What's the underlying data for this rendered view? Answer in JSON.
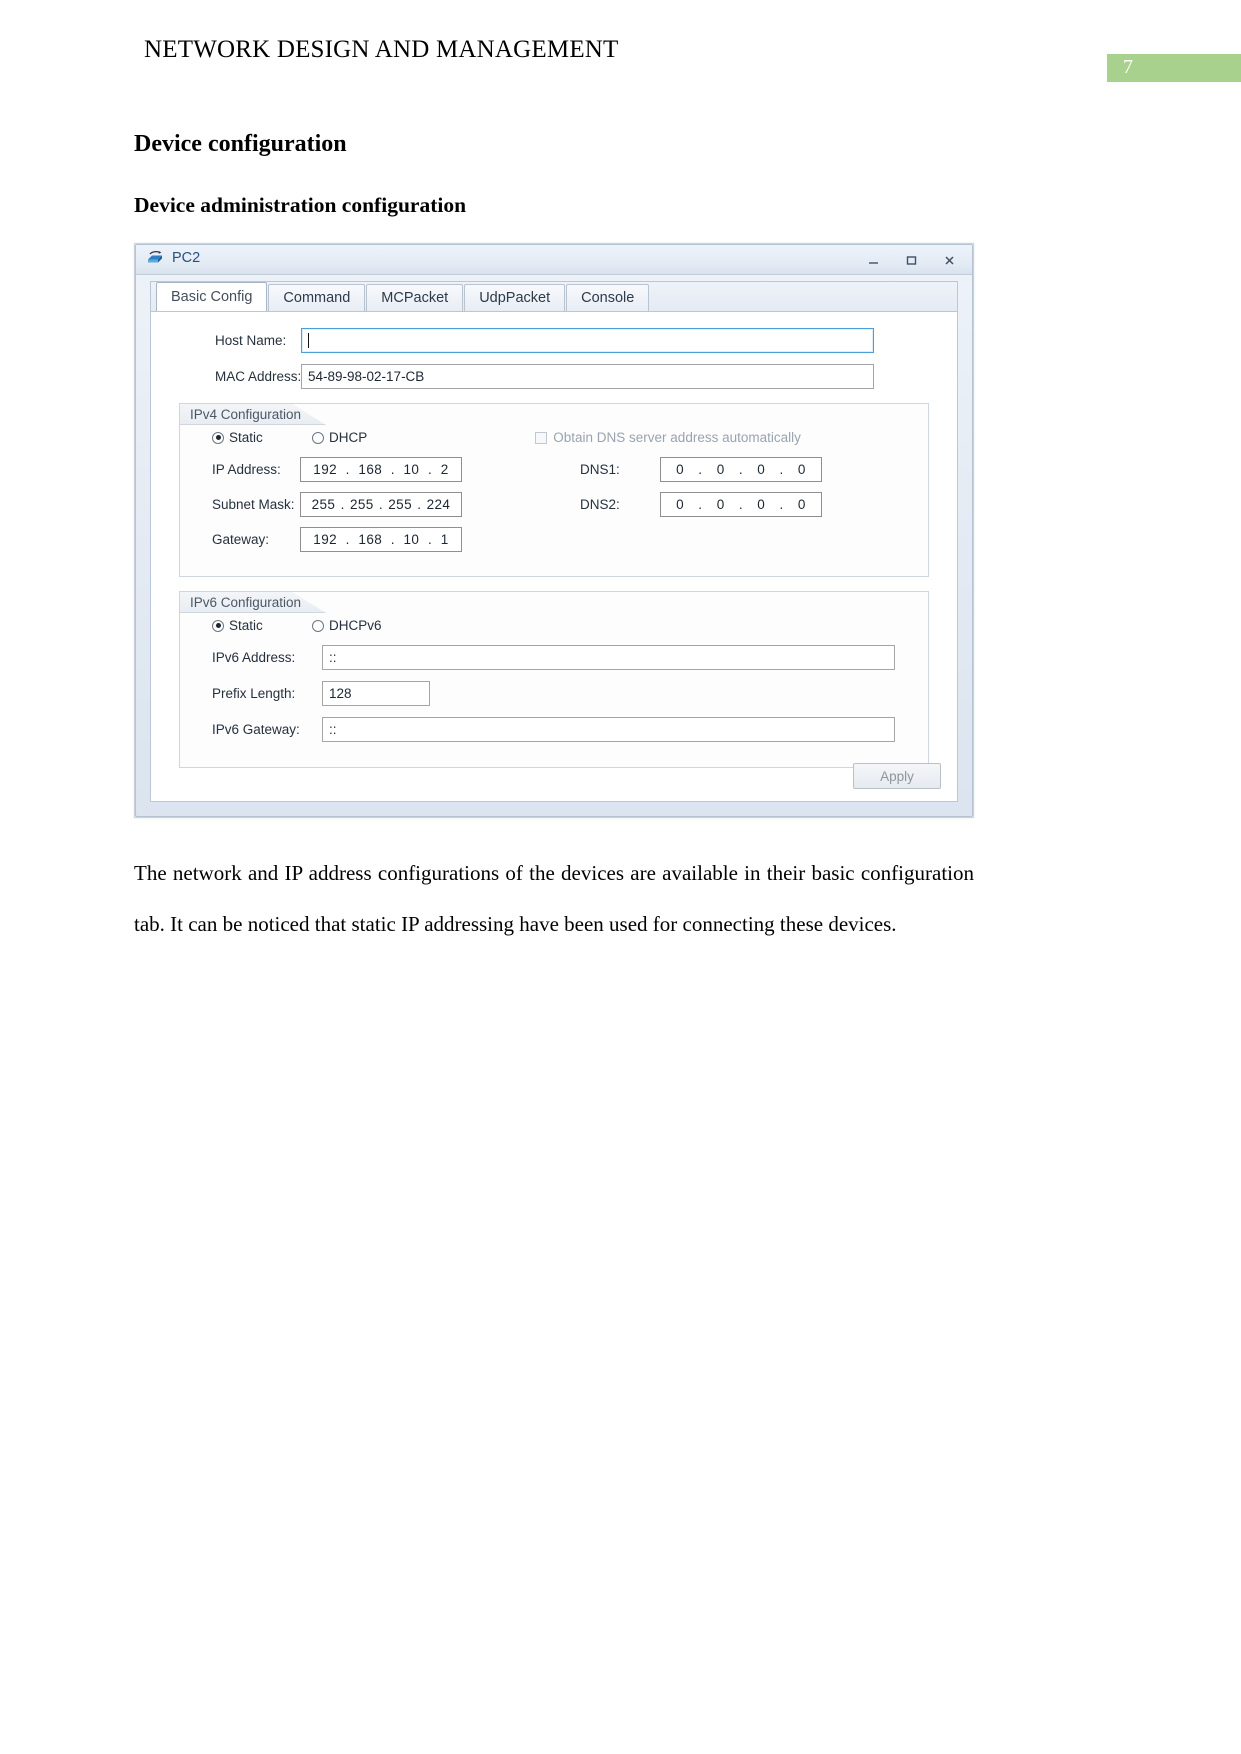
{
  "document": {
    "header_title": "NETWORK DESIGN AND MANAGEMENT",
    "page_number": "7",
    "page_number_color": "#a9d18e",
    "heading1": "Device configuration",
    "heading2": "Device administration configuration",
    "paragraph": "The network and IP address configurations of the devices are available in their basic configuration tab. It can be noticed that static IP addressing have been used for connecting these devices."
  },
  "window": {
    "title": "PC2",
    "icon": "pc-device-icon",
    "controls": {
      "minimize": "–",
      "maximize": "❐",
      "close": "X"
    },
    "tabs": [
      {
        "label": "Basic Config",
        "active": true
      },
      {
        "label": "Command",
        "active": false
      },
      {
        "label": "MCPacket",
        "active": false
      },
      {
        "label": "UdpPacket",
        "active": false
      },
      {
        "label": "Console",
        "active": false
      }
    ],
    "basic_config": {
      "host_name": {
        "label": "Host Name:",
        "value": "",
        "focused": true
      },
      "mac_address": {
        "label": "MAC Address:",
        "value": "54-89-98-02-17-CB"
      },
      "ipv4": {
        "group_title": "IPv4 Configuration",
        "mode_static": "Static",
        "mode_dhcp": "DHCP",
        "mode_selected": "Static",
        "obtain_dns_label": "Obtain DNS server address automatically",
        "obtain_dns_checked": false,
        "ip_address": {
          "label": "IP Address:",
          "octets": [
            "192",
            "168",
            "10",
            "2"
          ]
        },
        "subnet_mask": {
          "label": "Subnet Mask:",
          "octets": [
            "255",
            "255",
            "255",
            "224"
          ]
        },
        "gateway": {
          "label": "Gateway:",
          "octets": [
            "192",
            "168",
            "10",
            "1"
          ]
        },
        "dns1": {
          "label": "DNS1:",
          "octets": [
            "0",
            "0",
            "0",
            "0"
          ]
        },
        "dns2": {
          "label": "DNS2:",
          "octets": [
            "0",
            "0",
            "0",
            "0"
          ]
        }
      },
      "ipv6": {
        "group_title": "IPv6 Configuration",
        "mode_static": "Static",
        "mode_dhcpv6": "DHCPv6",
        "mode_selected": "Static",
        "ipv6_address": {
          "label": "IPv6 Address:",
          "value": "::"
        },
        "prefix_length": {
          "label": "Prefix Length:",
          "value": "128"
        },
        "ipv6_gateway": {
          "label": "IPv6 Gateway:",
          "value": "::"
        }
      },
      "apply_button": "Apply"
    }
  }
}
